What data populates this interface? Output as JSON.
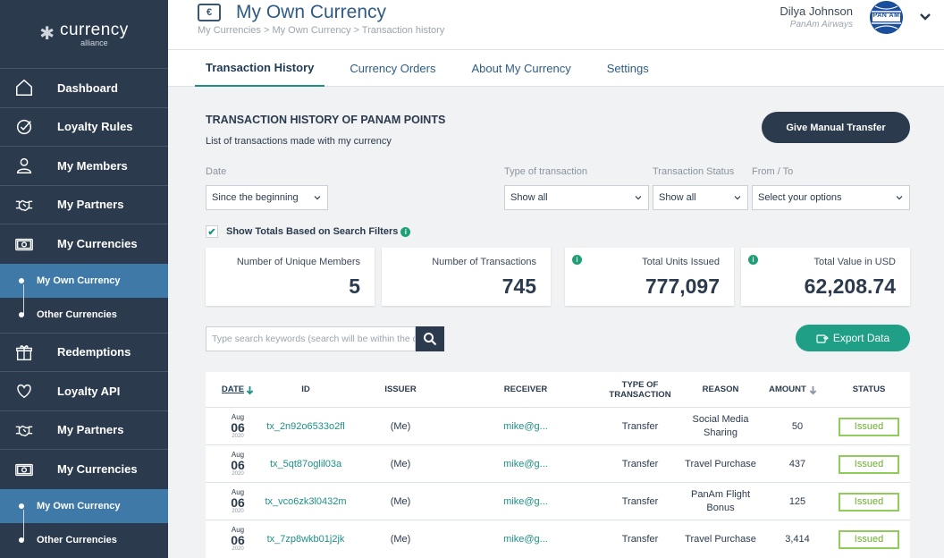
{
  "logo": {
    "main": "currency",
    "sub": "alliance"
  },
  "sidebar": {
    "items": [
      {
        "label": "Dashboard",
        "icon": "home-icon"
      },
      {
        "label": "Loyalty Rules",
        "icon": "check-circle-icon"
      },
      {
        "label": "My Members",
        "icon": "user-icon"
      },
      {
        "label": "My Partners",
        "icon": "handshake-icon"
      },
      {
        "label": "My Currencies",
        "icon": "banknote-icon"
      }
    ],
    "sub1": [
      {
        "label": "My Own Currency",
        "active": true
      },
      {
        "label": "Other Currencies",
        "active": false
      }
    ],
    "items2": [
      {
        "label": "Redemptions",
        "icon": "gift-icon"
      },
      {
        "label": "Loyalty API",
        "icon": "heart-icon"
      },
      {
        "label": "My Partners",
        "icon": "handshake-icon"
      },
      {
        "label": "My Currencies",
        "icon": "banknote-icon"
      }
    ],
    "sub2": [
      {
        "label": "My Own Currency",
        "active": true
      },
      {
        "label": "Other Currencies",
        "active": false
      }
    ]
  },
  "header": {
    "title": "My Own Currency",
    "breadcrumb": "My Currencies > My Own Currency > Transaction history",
    "user_name": "Dilya Johnson",
    "user_org": "PanAm Airways",
    "avatar_text": "PAN AM"
  },
  "tabs": [
    {
      "label": "Transaction History",
      "active": true
    },
    {
      "label": "Currency Orders",
      "active": false
    },
    {
      "label": "About My Currency",
      "active": false
    },
    {
      "label": "Settings",
      "active": false
    }
  ],
  "section": {
    "title": "TRANSACTION HISTORY OF PANAM POINTS",
    "subtitle": "List of transactions made with my currency",
    "manual_transfer": "Give Manual Transfer"
  },
  "filters": {
    "date_label": "Date",
    "date_value": "Since the beginning",
    "type_label": "Type of transaction",
    "type_value": "Show all",
    "status_label": "Transaction Status",
    "status_value": "Show all",
    "fromto_label": "From / To",
    "fromto_value": "Select your options",
    "show_totals": "Show Totals Based on Search Filters"
  },
  "stats": [
    {
      "label": "Number of Unique Members",
      "value": "5",
      "info": false
    },
    {
      "label": "Number of Transactions",
      "value": "745",
      "info": false
    },
    {
      "label": "Total Units Issued",
      "value": "777,097",
      "info": true
    },
    {
      "label": "Total Value in USD",
      "value": "62,208.74",
      "info": true
    }
  ],
  "search": {
    "placeholder": "Type search keywords (search will be within the d"
  },
  "export_label": "Export Data",
  "table": {
    "headers": {
      "date": "DATE",
      "id": "ID",
      "issuer": "ISSUER",
      "receiver": "RECEIVER",
      "type_line1": "TYPE OF",
      "type_line2": "TRANSACTION",
      "reason": "REASON",
      "amount": "AMOUNT",
      "status": "STATUS"
    },
    "rows": [
      {
        "month": "Aug",
        "day": "06",
        "year": "2020",
        "id": "tx_2n92o6533o2fl",
        "issuer": "(Me)",
        "receiver": "mike@g...",
        "type": "Transfer",
        "reason_l1": "Social Media",
        "reason_l2": "Sharing",
        "amount": "50",
        "status": "Issued"
      },
      {
        "month": "Aug",
        "day": "06",
        "year": "2020",
        "id": "tx_5qt87oglil03a",
        "issuer": "(Me)",
        "receiver": "mike@g...",
        "type": "Transfer",
        "reason_l1": "Travel Purchase",
        "reason_l2": "",
        "amount": "437",
        "status": "Issued"
      },
      {
        "month": "Aug",
        "day": "06",
        "year": "2020",
        "id": "tx_vco6zk3l0432m",
        "issuer": "(Me)",
        "receiver": "mike@g...",
        "type": "Transfer",
        "reason_l1": "PanAm Flight",
        "reason_l2": "Bonus",
        "amount": "125",
        "status": "Issued"
      },
      {
        "month": "Aug",
        "day": "06",
        "year": "2020",
        "id": "tx_7zp8wkb01j2jk",
        "issuer": "(Me)",
        "receiver": "mike@g...",
        "type": "Transfer",
        "reason_l1": "Travel Purchase",
        "reason_l2": "",
        "amount": "3,414",
        "status": "Issued"
      }
    ]
  },
  "colors": {
    "sidebar": "#2b3a4d",
    "active_sub": "#3e79a8",
    "accent": "#1f9f86",
    "badge": "#8fcc5c",
    "title": "#2e5c86"
  }
}
